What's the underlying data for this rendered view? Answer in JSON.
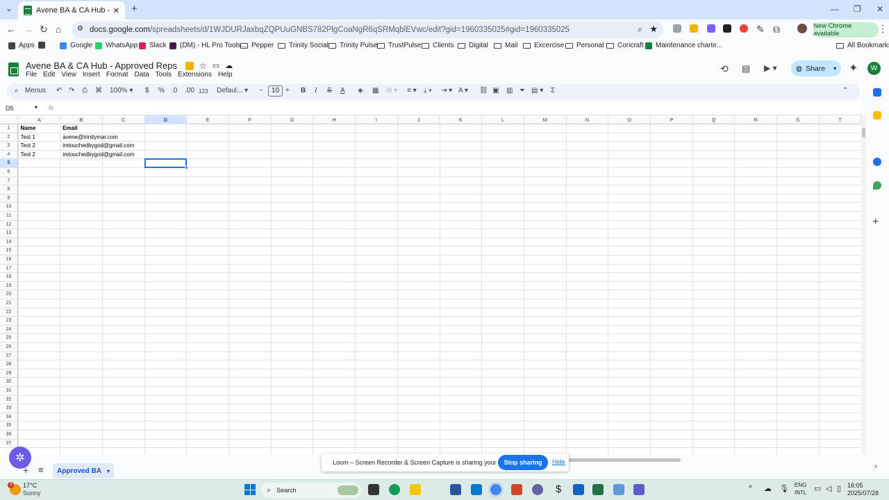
{
  "browser": {
    "tab_title": "Avene BA & CA Hub - Approved",
    "url_host": "docs.google.com",
    "url_path": "/spreadsheets/d/1WJDURJaxbqZQPUuGNBS782PlgCoaNgR6qSRMqblEVwc/edit?gid=1960335025#gid=1960335025",
    "new_chrome_label": "New Chrome available"
  },
  "bookmarks": [
    {
      "label": "Apps",
      "icon": "apps-grid-icon",
      "type": "icon"
    },
    {
      "label": "",
      "icon": "grid-icon",
      "type": "icon"
    },
    {
      "label": "Google",
      "icon": "google-icon",
      "type": "icon",
      "color": "#4285f4"
    },
    {
      "label": "WhatsApp",
      "icon": "whatsapp-icon",
      "type": "icon",
      "color": "#25d366"
    },
    {
      "label": "Slack",
      "icon": "slack-icon",
      "type": "icon",
      "color": "#e01e5a"
    },
    {
      "label": "(DM) - HL Pro Tools...",
      "icon": "slack-icon",
      "type": "icon",
      "color": "#4a154b"
    },
    {
      "label": "Pepper",
      "icon": "folder-icon",
      "type": "folder"
    },
    {
      "label": "Trinity Social",
      "icon": "folder-icon",
      "type": "folder"
    },
    {
      "label": "Trinity Pulse",
      "icon": "folder-icon",
      "type": "folder"
    },
    {
      "label": "TrustPulse",
      "icon": "folder-icon",
      "type": "folder"
    },
    {
      "label": "Clients",
      "icon": "folder-icon",
      "type": "folder"
    },
    {
      "label": "Digital",
      "icon": "folder-icon",
      "type": "folder"
    },
    {
      "label": "Mail",
      "icon": "folder-icon",
      "type": "folder"
    },
    {
      "label": "Excercise",
      "icon": "folder-icon",
      "type": "folder"
    },
    {
      "label": "Personal",
      "icon": "folder-icon",
      "type": "folder"
    },
    {
      "label": "Coricraft",
      "icon": "folder-icon",
      "type": "folder"
    },
    {
      "label": "Maintenance charte...",
      "icon": "sheets-icon",
      "type": "icon",
      "color": "#188038"
    }
  ],
  "all_bookmarks_label": "All Bookmarks",
  "sheets": {
    "doc_title": "Avene BA & CA Hub - Approved Reps",
    "menus": [
      "File",
      "Edit",
      "View",
      "Insert",
      "Format",
      "Data",
      "Tools",
      "Extensions",
      "Help"
    ],
    "share_label": "Share",
    "avatar_letter": "W",
    "toolbar": {
      "menus_label": "Menus",
      "zoom": "100%",
      "currency": "$",
      "percent": "%",
      "dec_decrease": ".0",
      "dec_increase": ".00",
      "number_format": "123",
      "font": "Defaul...",
      "font_size": "10",
      "sum": "Σ"
    },
    "name_box": "D5",
    "formula": "",
    "columns": [
      "A",
      "B",
      "C",
      "D",
      "E",
      "F",
      "G",
      "H",
      "I",
      "J",
      "K",
      "L",
      "M",
      "N",
      "O",
      "P",
      "Q",
      "R",
      "S",
      "T"
    ],
    "selected_column": "D",
    "selected_row": 5,
    "row_count": 37,
    "rows": [
      [
        "Name",
        "Email"
      ],
      [
        "Test 1",
        "avene@trinitymar.com"
      ],
      [
        "Test 2",
        "imtouchedbygod@gmail.com"
      ],
      [
        "Test 2",
        "imtouchedbygod@gmail.com"
      ]
    ],
    "sheet_tab": "Approved BA"
  },
  "loom": {
    "message": "Loom – Screen Recorder & Screen Capture is sharing your screen.",
    "stop_label": "Stop sharing",
    "hide_label": "Hide"
  },
  "taskbar": {
    "weather_temp": "17°C",
    "weather_desc": "Sunny",
    "weather_badge": "3",
    "search_label": "Search",
    "lang_1": "ENG",
    "lang_2": "INTL",
    "time": "16:05",
    "date": "2025/07/28"
  }
}
